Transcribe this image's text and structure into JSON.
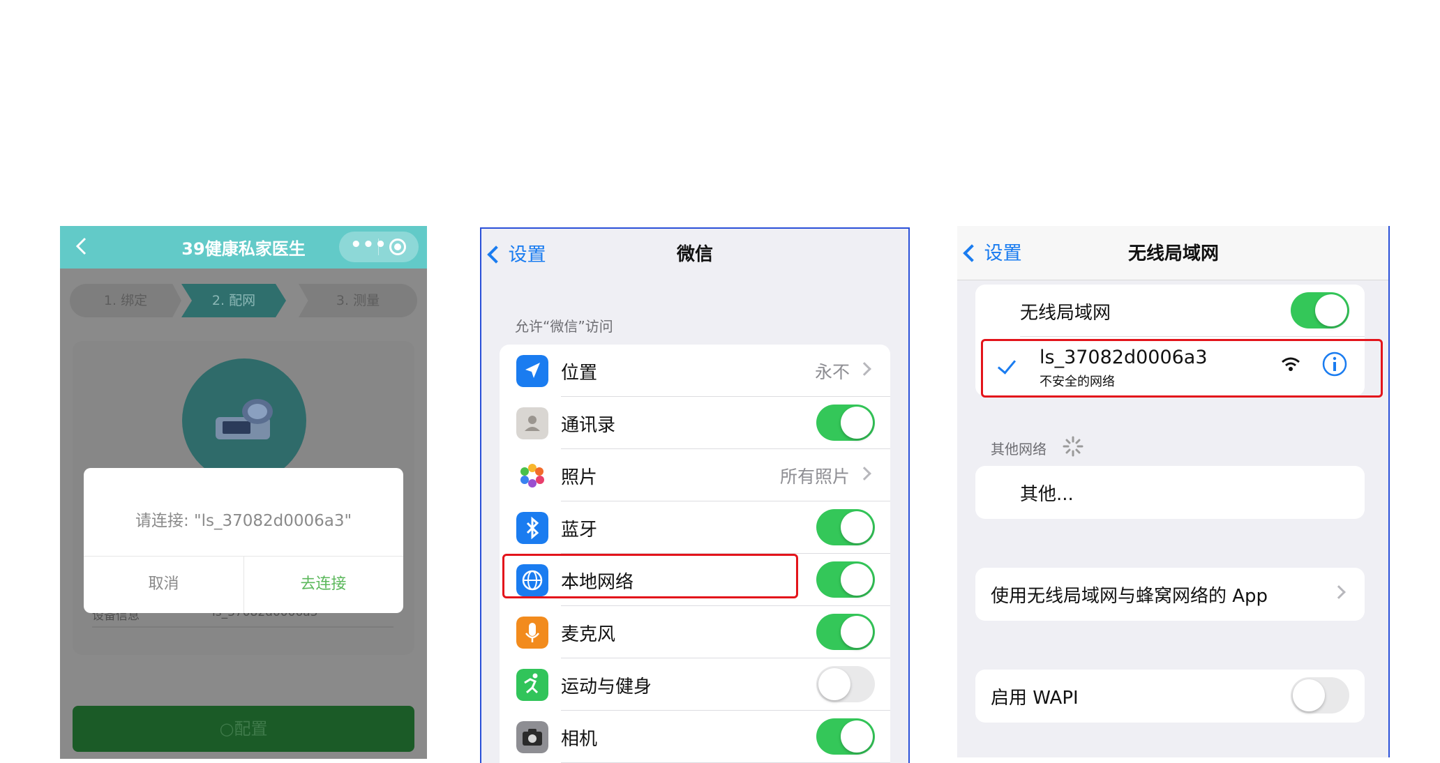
{
  "panel1": {
    "title": "39健康私家医生",
    "steps": [
      "1. 绑定",
      "2. 配网",
      "3. 测量"
    ],
    "info_label": "设备信息",
    "info_value": "ls_37082d0006a3",
    "dialog_message": "请连接: \"ls_37082d0006a3\"",
    "dialog_cancel": "取消",
    "dialog_confirm": "去连接",
    "config_button": "○配置",
    "colors": {
      "topbar": "#62cac8",
      "confirm": "#5cb85c"
    }
  },
  "panel2": {
    "back_label": "设置",
    "title": "微信",
    "section_header": "允许“微信”访问",
    "rows": [
      {
        "label": "位置",
        "value": "永不",
        "icon": "location-arrow-icon"
      },
      {
        "label": "通讯录",
        "toggle": "on",
        "icon": "contacts-icon"
      },
      {
        "label": "照片",
        "value": "所有照片",
        "icon": "photos-icon"
      },
      {
        "label": "蓝牙",
        "toggle": "on",
        "icon": "bluetooth-icon"
      },
      {
        "label": "本地网络",
        "toggle": "on",
        "icon": "globe-icon",
        "highlighted": true
      },
      {
        "label": "麦克风",
        "toggle": "on",
        "icon": "microphone-icon"
      },
      {
        "label": "运动与健身",
        "toggle": "off",
        "icon": "fitness-icon"
      },
      {
        "label": "相机",
        "toggle": "on",
        "icon": "camera-icon"
      }
    ]
  },
  "panel3": {
    "back_label": "设置",
    "title": "无线局域网",
    "wlan_label": "无线局域网",
    "wlan_toggle": "on",
    "connected_network": "ls_37082d0006a3",
    "connected_subtitle": "不安全的网络",
    "other_networks_header": "其他网络",
    "other_label": "其他...",
    "apps_label": "使用无线局域网与蜂窝网络的 App",
    "wapi_label": "启用 WAPI",
    "wapi_toggle": "off",
    "colors": {
      "accent": "#1a7cf0",
      "toggle_on": "#34c759",
      "highlight": "#e3141b"
    }
  }
}
